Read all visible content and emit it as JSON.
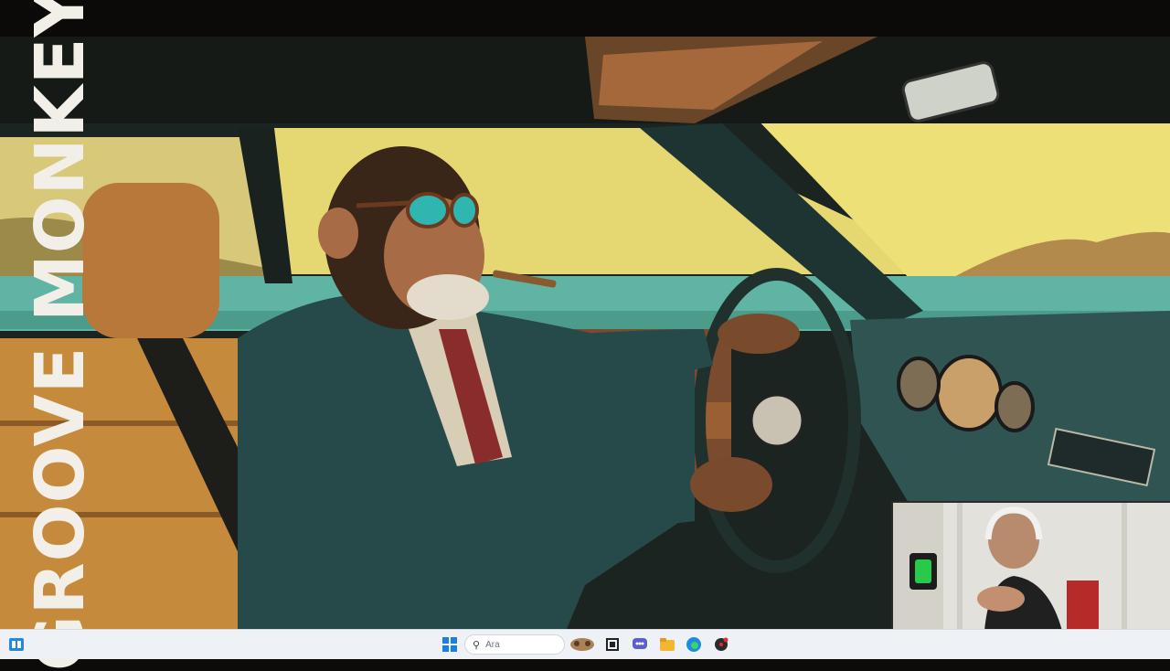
{
  "overlay": {
    "title": "GROOVE MONKEY"
  },
  "taskbar": {
    "search_placeholder": "Ara",
    "icons": [
      "widgets-icon",
      "windows-start-icon",
      "search-icon",
      "search-highlight-icon",
      "task-view-icon",
      "chat-icon",
      "file-explorer-icon",
      "edge-browser-icon",
      "music-app-icon"
    ]
  },
  "colors": {
    "sky": "#e8dc6e",
    "sea": "#5fb4a4",
    "suit": "#26494a",
    "seat": "#c58a3c",
    "taskbar": "#eef1f6"
  }
}
